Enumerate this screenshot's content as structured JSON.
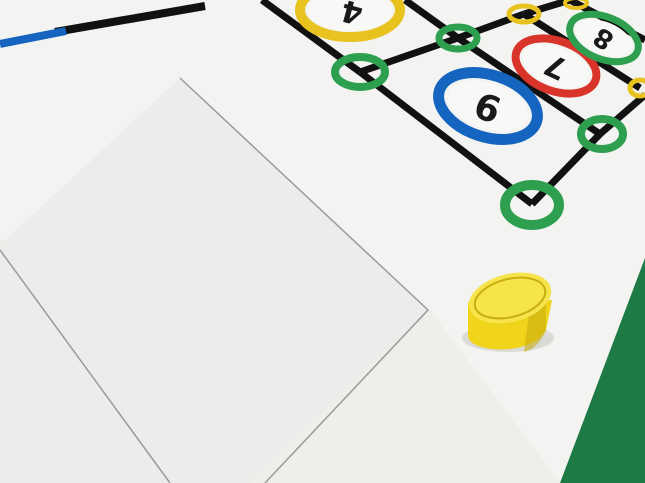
{
  "scene": {
    "colors": {
      "floor": "#1d7a45",
      "mat": "#f3f3f1",
      "mat_shade": "#e9e9e6",
      "line_black": "#111111",
      "line_blue": "#1565c0",
      "ring_green": "#2e9e4f",
      "ring_yellow": "#e8c21e",
      "ring_red": "#d8342a",
      "ring_blue": "#1565c0",
      "ring_inner": "#f8f8f6",
      "paper": "#ececea",
      "paper_edge": "#9a9a9a",
      "cylinder": "#f0d41c",
      "cylinder_dark": "#c9ae10",
      "cylinder_top": "#f7e34a"
    },
    "number_circles": [
      {
        "label": "4",
        "ring": "yellow"
      },
      {
        "label": "7",
        "ring": "red"
      },
      {
        "label": "8",
        "ring": "green"
      },
      {
        "label": "9",
        "ring": "blue"
      }
    ]
  }
}
